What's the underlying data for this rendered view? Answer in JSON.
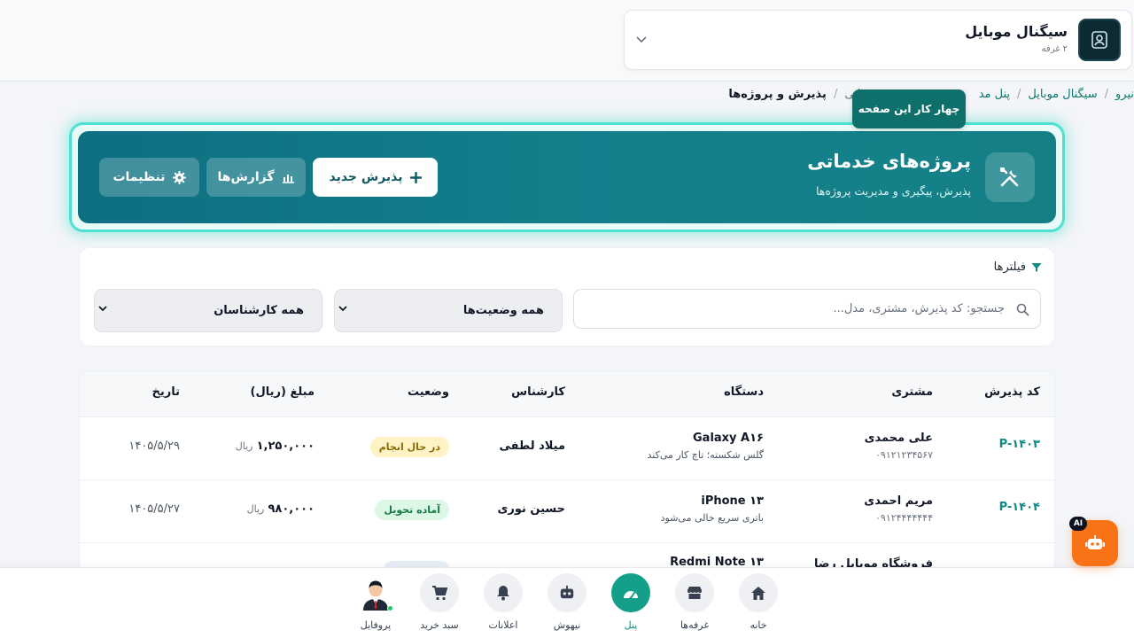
{
  "header": {
    "shop_name": "سیگنال موبایل",
    "shop_sub": "۲ غرفه"
  },
  "breadcrumb": {
    "items": [
      "نیرو",
      "سیگنال موبایل",
      "پنل مد",
      "ماتی",
      "پذیرش و پروژه‌ها"
    ]
  },
  "tooltip": {
    "text": "چهار کار این صفحه"
  },
  "hero": {
    "title": "پروژه‌های خدماتی",
    "subtitle": "پذیرش، پیگیری و مدیریت پروژه‌ها",
    "new_label": "پذیرش جدید",
    "reports_label": "گزارش‌ها",
    "settings_label": "تنظیمات",
    "icon": "tools-icon"
  },
  "filters": {
    "title": "فیلترها",
    "search_placeholder": "جستجو: کد پذیرش، مشتری، مدل...",
    "status_value": "همه وضعیت‌ها",
    "tech_value": "همه کارشناسان"
  },
  "table": {
    "headers": [
      "کد پذیرش",
      "مشتری",
      "دستگاه",
      "کارشناس",
      "وضعیت",
      "مبلغ (ریال)",
      "تاریخ"
    ],
    "currency": "ریال",
    "rows": [
      {
        "code": "P-۱۴۰۳",
        "customer": "علی محمدی",
        "phone": "۰۹۱۲۱۲۳۴۵۶۷",
        "device": "Galaxy A۱۶",
        "issue": "گلس شکسته؛ تاچ کار می‌کند",
        "tech": "میلاد لطفی",
        "status": "در حال انجام",
        "amount": "۱,۲۵۰,۰۰۰",
        "date": "۱۴۰۵/۵/۲۹"
      },
      {
        "code": "P-۱۴۰۴",
        "customer": "مریم احمدی",
        "phone": "۰۹۱۲۴۴۴۴۴۴۴",
        "device": "iPhone ۱۳",
        "issue": "باتری سریع خالی می‌شود",
        "tech": "حسین نوری",
        "status": "آماده تحویل",
        "amount": "۹۸۰,۰۰۰",
        "date": "۱۴۰۵/۵/۲۷"
      },
      {
        "customer": "فروشگاه موبایل رضا",
        "device": "Redmi Note ۱۳"
      }
    ]
  },
  "ai": {
    "tag": "AI"
  },
  "bottom_nav": {
    "items": [
      "خانه",
      "غرفه‌ها",
      "پنل",
      "نیهوش",
      "اعلانات",
      "سبد خرید",
      "پروفایل"
    ]
  },
  "colors": {
    "accent": "#14a088",
    "hero": "#12818c",
    "ai": "#f97316"
  }
}
